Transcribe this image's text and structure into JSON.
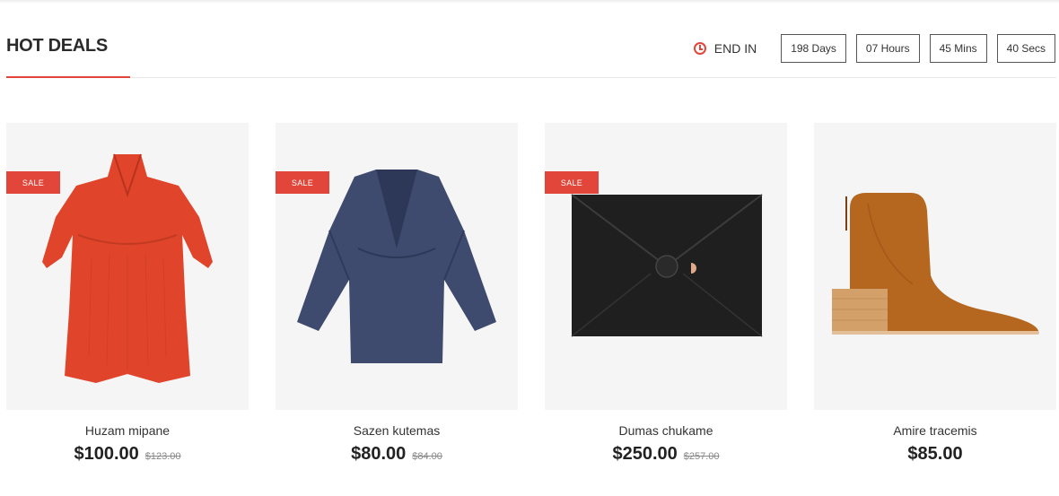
{
  "section": {
    "title": "HOT DEALS",
    "end_label": "END IN",
    "countdown": {
      "days": "198 Days",
      "hours": "07 Hours",
      "mins": "45 Mins",
      "secs": "40 Secs"
    }
  },
  "colors": {
    "accent": "#e2463a"
  },
  "products": [
    {
      "name": "Huzam mipane",
      "price": "$100.00",
      "old_price": "$123.00",
      "badge": "SALE",
      "image": "red-dress"
    },
    {
      "name": "Sazen kutemas",
      "price": "$80.00",
      "old_price": "$84.00",
      "badge": "SALE",
      "image": "denim-dress"
    },
    {
      "name": "Dumas chukame",
      "price": "$250.00",
      "old_price": "$257.00",
      "badge": "SALE",
      "image": "black-clutch"
    },
    {
      "name": "Amire tracemis",
      "price": "$85.00",
      "image": "brown-boot"
    }
  ]
}
